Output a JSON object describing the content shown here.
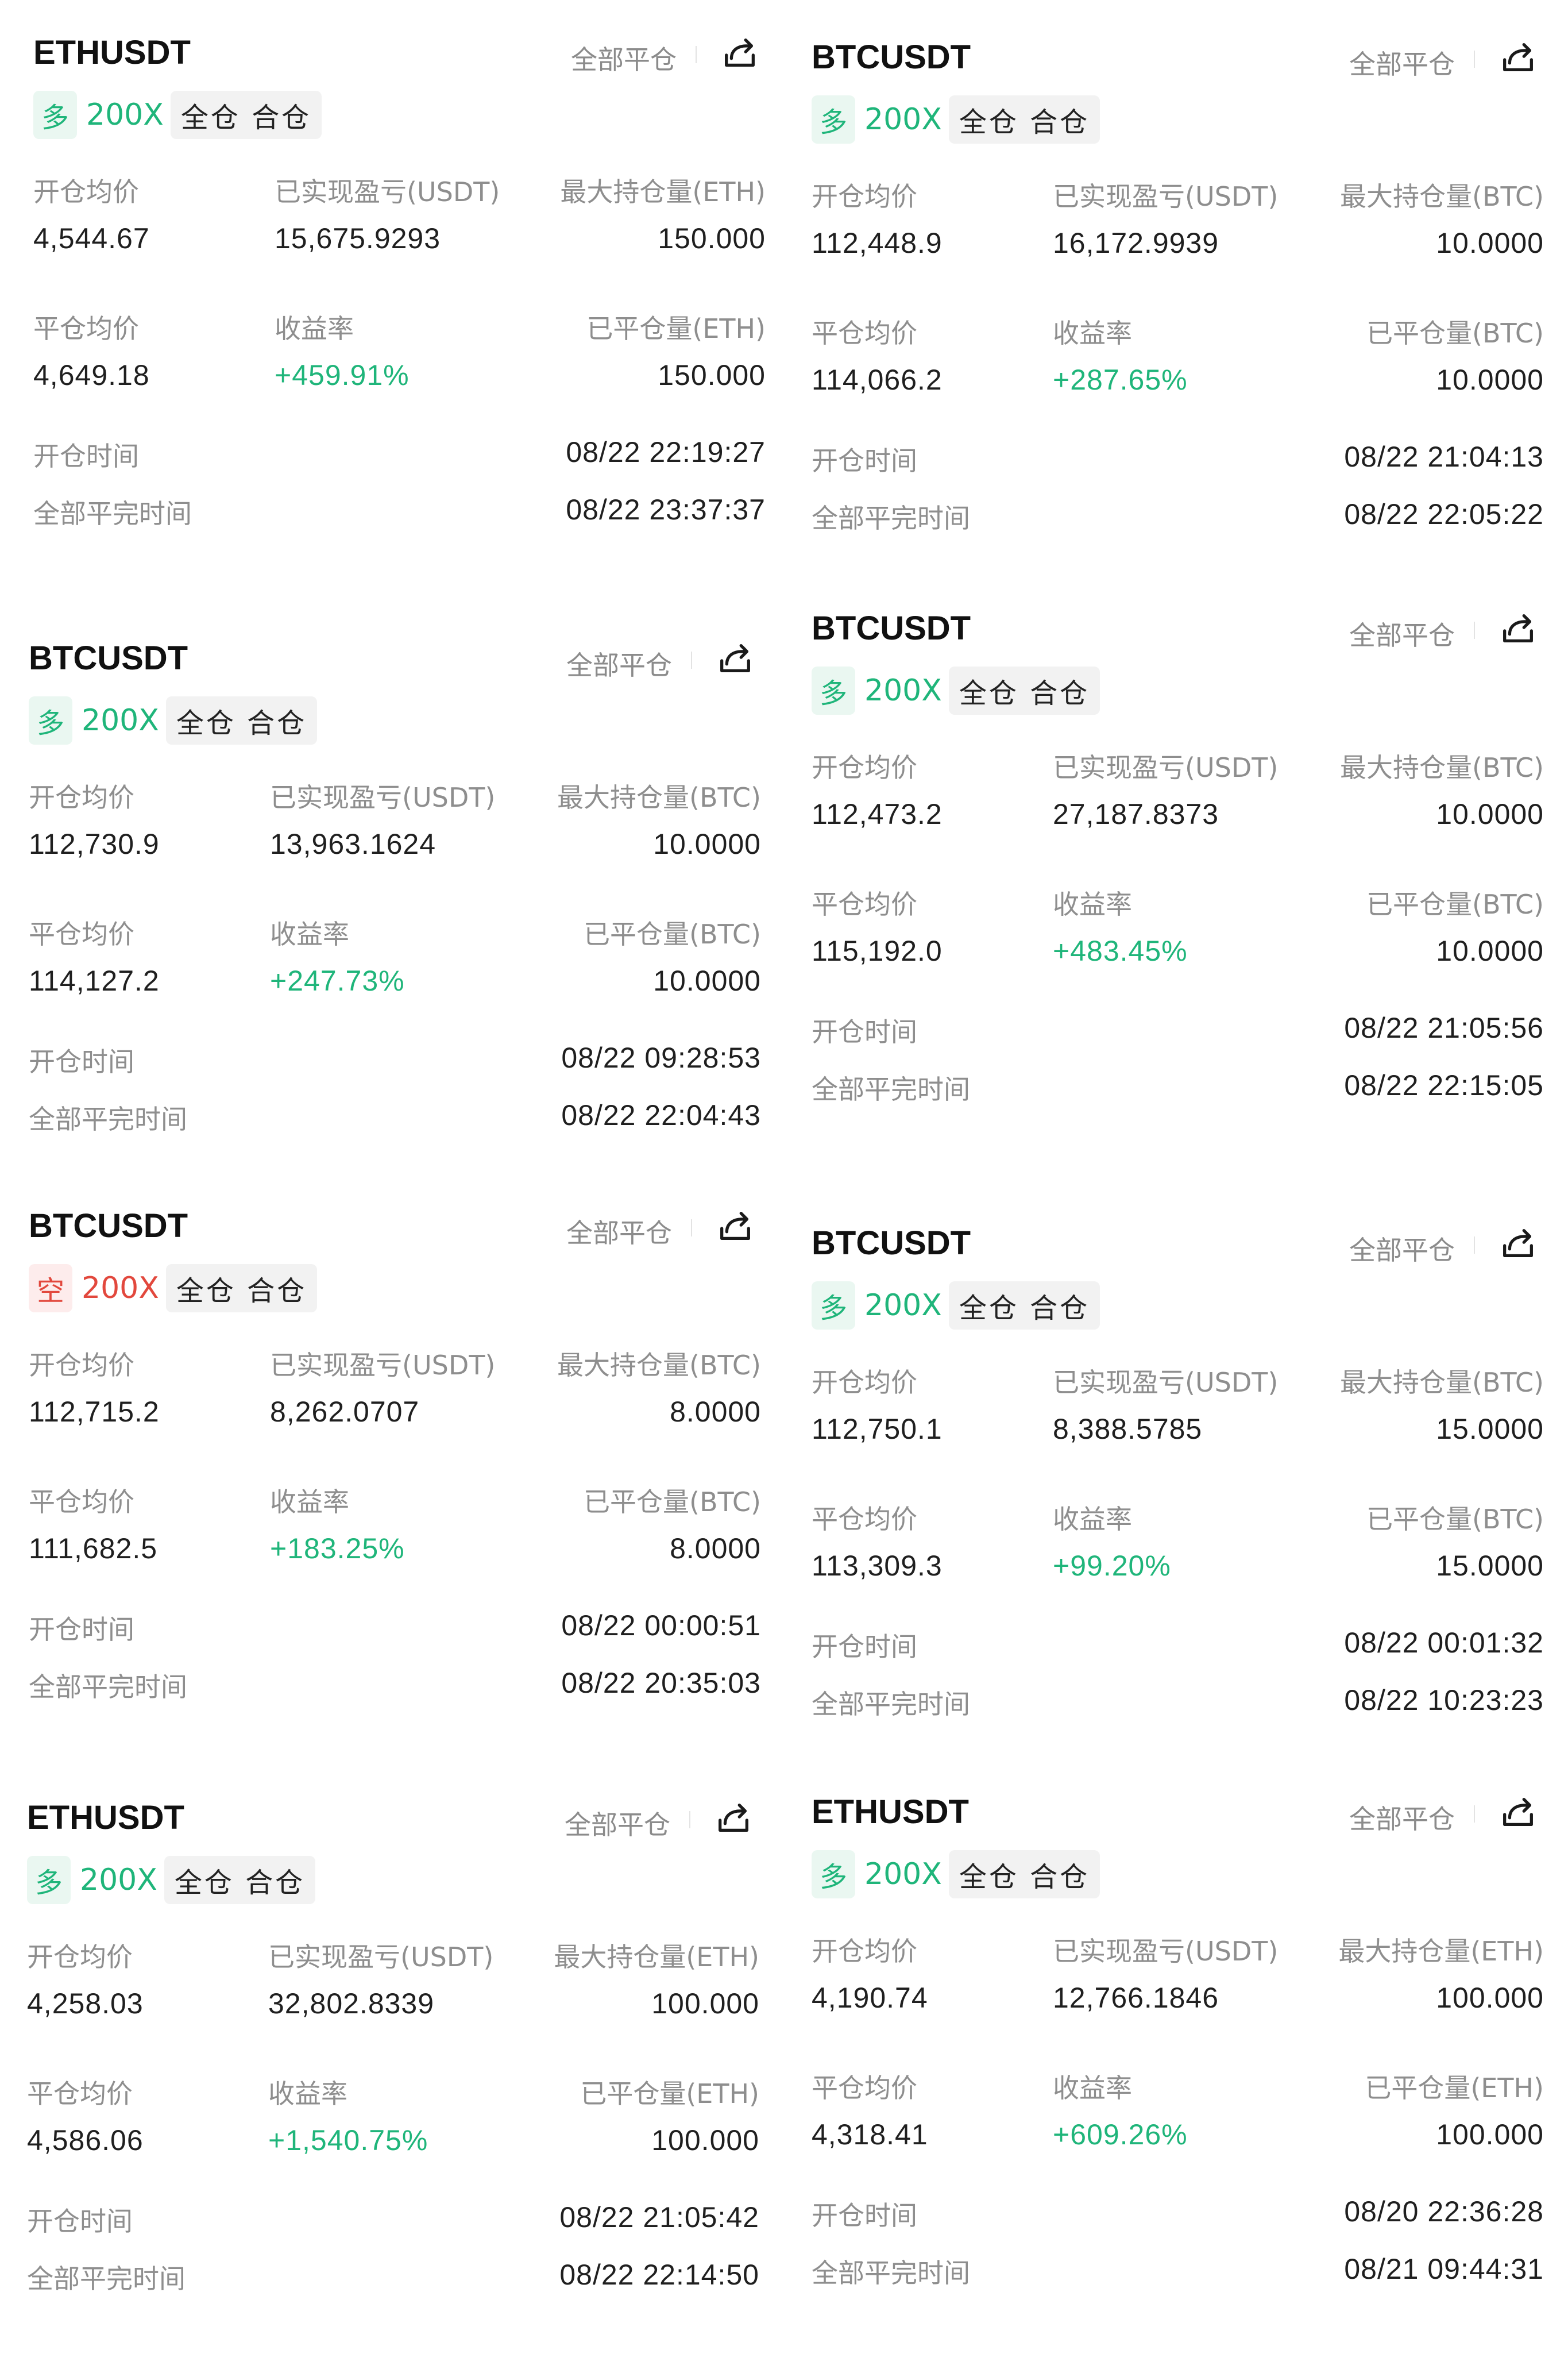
{
  "labels": {
    "close_all": "全部平仓",
    "open_avg": "开仓均价",
    "realized_pnl": "已实现盈亏(USDT)",
    "close_avg": "平仓均价",
    "yield": "收益率",
    "open_time": "开仓时间",
    "fully_closed_time": "全部平完时间",
    "margin_mode": "全仓 合仓"
  },
  "icons": {
    "share": "share-icon"
  },
  "colors": {
    "long": "#1fb57a",
    "short": "#e2483d",
    "label": "#8e8e8e"
  },
  "cards": [
    {
      "symbol": "ETHUSDT",
      "side": "多",
      "side_type": "long",
      "leverage": "200X",
      "open_avg": "4,544.67",
      "realized_pnl": "15,675.9293",
      "max_pos_label": "最大持仓量(ETH)",
      "max_pos": "150.000",
      "close_avg": "4,649.18",
      "yield": "+459.91%",
      "closed_label": "已平仓量(ETH)",
      "closed": "150.000",
      "open_time": "08/22 22:19:27",
      "close_time": "08/22 23:37:37"
    },
    {
      "symbol": "BTCUSDT",
      "side": "多",
      "side_type": "long",
      "leverage": "200X",
      "open_avg": "112,448.9",
      "realized_pnl": "16,172.9939",
      "max_pos_label": "最大持仓量(BTC)",
      "max_pos": "10.0000",
      "close_avg": "114,066.2",
      "yield": "+287.65%",
      "closed_label": "已平仓量(BTC)",
      "closed": "10.0000",
      "open_time": "08/22 21:04:13",
      "close_time": "08/22 22:05:22"
    },
    {
      "symbol": "BTCUSDT",
      "side": "多",
      "side_type": "long",
      "leverage": "200X",
      "open_avg": "112,730.9",
      "realized_pnl": "13,963.1624",
      "max_pos_label": "最大持仓量(BTC)",
      "max_pos": "10.0000",
      "close_avg": "114,127.2",
      "yield": "+247.73%",
      "closed_label": "已平仓量(BTC)",
      "closed": "10.0000",
      "open_time": "08/22 09:28:53",
      "close_time": "08/22 22:04:43"
    },
    {
      "symbol": "BTCUSDT",
      "side": "多",
      "side_type": "long",
      "leverage": "200X",
      "open_avg": "112,473.2",
      "realized_pnl": "27,187.8373",
      "max_pos_label": "最大持仓量(BTC)",
      "max_pos": "10.0000",
      "close_avg": "115,192.0",
      "yield": "+483.45%",
      "closed_label": "已平仓量(BTC)",
      "closed": "10.0000",
      "open_time": "08/22 21:05:56",
      "close_time": "08/22 22:15:05"
    },
    {
      "symbol": "BTCUSDT",
      "side": "空",
      "side_type": "short",
      "leverage": "200X",
      "open_avg": "112,715.2",
      "realized_pnl": "8,262.0707",
      "max_pos_label": "最大持仓量(BTC)",
      "max_pos": "8.0000",
      "close_avg": "111,682.5",
      "yield": "+183.25%",
      "closed_label": "已平仓量(BTC)",
      "closed": "8.0000",
      "open_time": "08/22 00:00:51",
      "close_time": "08/22 20:35:03"
    },
    {
      "symbol": "BTCUSDT",
      "side": "多",
      "side_type": "long",
      "leverage": "200X",
      "open_avg": "112,750.1",
      "realized_pnl": "8,388.5785",
      "max_pos_label": "最大持仓量(BTC)",
      "max_pos": "15.0000",
      "close_avg": "113,309.3",
      "yield": "+99.20%",
      "closed_label": "已平仓量(BTC)",
      "closed": "15.0000",
      "open_time": "08/22 00:01:32",
      "close_time": "08/22 10:23:23"
    },
    {
      "symbol": "ETHUSDT",
      "side": "多",
      "side_type": "long",
      "leverage": "200X",
      "open_avg": "4,258.03",
      "realized_pnl": "32,802.8339",
      "max_pos_label": "最大持仓量(ETH)",
      "max_pos": "100.000",
      "close_avg": "4,586.06",
      "yield": "+1,540.75%",
      "closed_label": "已平仓量(ETH)",
      "closed": "100.000",
      "open_time": "08/22 21:05:42",
      "close_time": "08/22 22:14:50"
    },
    {
      "symbol": "ETHUSDT",
      "side": "多",
      "side_type": "long",
      "leverage": "200X",
      "open_avg": "4,190.74",
      "realized_pnl": "12,766.1846",
      "max_pos_label": "最大持仓量(ETH)",
      "max_pos": "100.000",
      "close_avg": "4,318.41",
      "yield": "+609.26%",
      "closed_label": "已平仓量(ETH)",
      "closed": "100.000",
      "open_time": "08/20 22:36:28",
      "close_time": "08/21 09:44:31"
    }
  ]
}
